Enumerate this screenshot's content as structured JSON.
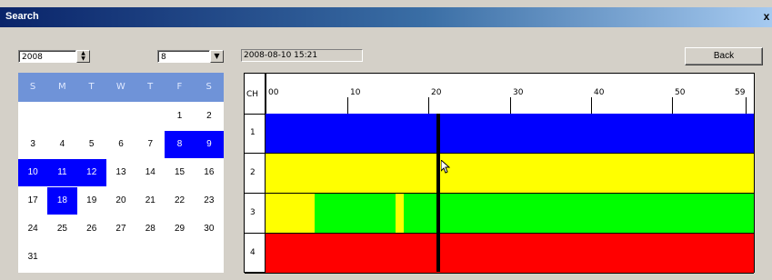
{
  "window": {
    "title": "Search",
    "close_glyph": "x"
  },
  "year_field": {
    "value": "2008",
    "spin_up": "▲",
    "spin_down": "▼"
  },
  "month_field": {
    "value": "8",
    "dropdown_glyph": "▼"
  },
  "timestamp": "2008-08-10 15:21",
  "back_button": "Back",
  "calendar": {
    "weekday_labels": [
      "S",
      "M",
      "T",
      "W",
      "T",
      "F",
      "S"
    ],
    "weeks": [
      [
        "",
        "",
        "",
        "",
        "",
        "1",
        "2"
      ],
      [
        "3",
        "4",
        "5",
        "6",
        "7",
        "8",
        "9"
      ],
      [
        "10",
        "11",
        "12",
        "13",
        "14",
        "15",
        "16"
      ],
      [
        "17",
        "18",
        "19",
        "20",
        "21",
        "22",
        "23"
      ],
      [
        "24",
        "25",
        "26",
        "27",
        "28",
        "29",
        "30"
      ],
      [
        "31",
        "",
        "",
        "",
        "",
        "",
        ""
      ]
    ],
    "highlighted_days": [
      "8",
      "9",
      "10",
      "11",
      "12",
      "18"
    ],
    "highlight_color": "#0000ff"
  },
  "timeline": {
    "ch_header": "CH",
    "tick_labels": [
      "00",
      "10",
      "20",
      "30",
      "40",
      "50",
      "59"
    ],
    "current_minute": 21.2,
    "channels": [
      {
        "label": "1",
        "segments": [
          {
            "start": 0,
            "end": 60,
            "color": "#0000ff"
          }
        ]
      },
      {
        "label": "2",
        "segments": [
          {
            "start": 0,
            "end": 60,
            "color": "#ffff00"
          }
        ]
      },
      {
        "label": "3",
        "segments": [
          {
            "start": 0,
            "end": 6,
            "color": "#ffff00"
          },
          {
            "start": 6,
            "end": 16,
            "color": "#00ff00"
          },
          {
            "start": 16,
            "end": 17,
            "color": "#ffff00"
          },
          {
            "start": 17,
            "end": 60,
            "color": "#00ff00"
          }
        ]
      },
      {
        "label": "4",
        "segments": [
          {
            "start": 0,
            "end": 60,
            "color": "#ff0000"
          }
        ]
      }
    ]
  }
}
